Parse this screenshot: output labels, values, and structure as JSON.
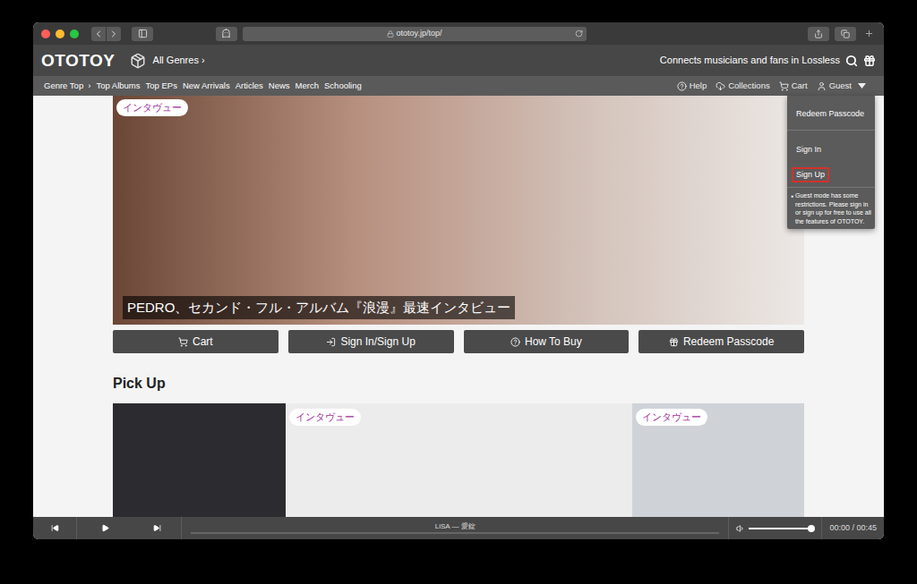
{
  "browser": {
    "url": "ototoy.jp/top/"
  },
  "header": {
    "logo": "OTOTOY",
    "genre": "All Genres ›",
    "tagline": "Connects musicians and fans in Lossless"
  },
  "nav": {
    "items": [
      {
        "label": "Genre Top",
        "separator": "›"
      },
      {
        "label": "Top Albums",
        "separator": ""
      },
      {
        "label": "Top EPs",
        "separator": ""
      },
      {
        "label": "New Arrivals",
        "separator": ""
      },
      {
        "label": "Articles",
        "separator": ""
      },
      {
        "label": "News",
        "separator": ""
      },
      {
        "label": "Merch",
        "separator": ""
      },
      {
        "label": "Schooling",
        "separator": ""
      }
    ],
    "right": [
      {
        "label": "Help"
      },
      {
        "label": "Collections"
      },
      {
        "label": "Cart"
      },
      {
        "label": "Guest"
      }
    ]
  },
  "account_menu": {
    "items": [
      {
        "label": "Redeem Passcode",
        "selected": false
      },
      {
        "label": "Sign In",
        "selected": false
      },
      {
        "label": "Sign Up",
        "selected": true
      }
    ],
    "bullet": "●",
    "note": "Guest mode has some restrictions. Please sign in or sign up for free to use all the features of OTOTOY."
  },
  "hero": {
    "badge": "インタヴュー",
    "caption": "PEDRO、セカンド・フル・アルバム『浪漫』最速インタビュー"
  },
  "actions": [
    {
      "label": "Cart"
    },
    {
      "label": "Sign In/Sign Up"
    },
    {
      "label": "How To Buy"
    },
    {
      "label": "Redeem Passcode"
    }
  ],
  "pickup": {
    "title": "Pick Up",
    "cards": [
      {
        "badge": ""
      },
      {
        "badge": "インタヴュー"
      },
      {
        "badge": "インタヴュー"
      }
    ]
  },
  "player": {
    "track": "LiSA — 愛錠",
    "time": "00:00 / 00:45",
    "volume": 0.95,
    "progress": 0
  }
}
